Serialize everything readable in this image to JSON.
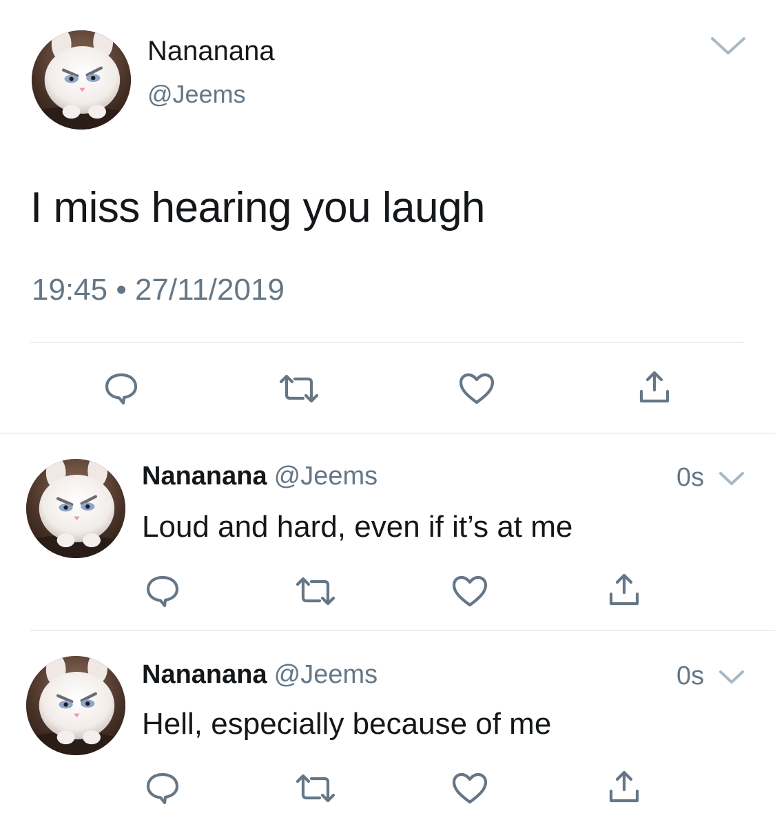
{
  "main_tweet": {
    "display_name": "Nananana",
    "handle": "@Jeems",
    "text": "I miss hearing you laugh",
    "timestamp": "19:45 • 27/11/2019",
    "avatar_icon": "white-rabbit-avatar",
    "actions": [
      "reply-icon",
      "retweet-icon",
      "like-icon",
      "share-icon"
    ]
  },
  "replies": [
    {
      "display_name": "Nananana",
      "handle": "@Jeems",
      "time_ago": "0s",
      "text": "Loud and hard, even if it’s at me"
    },
    {
      "display_name": "Nananana",
      "handle": "@Jeems",
      "time_ago": "0s",
      "text": "Hell, especially because of me"
    }
  ],
  "colors": {
    "primary_text": "#14171a",
    "secondary_text": "#657786",
    "icon": "#657786",
    "divider": "#d7dbde"
  }
}
